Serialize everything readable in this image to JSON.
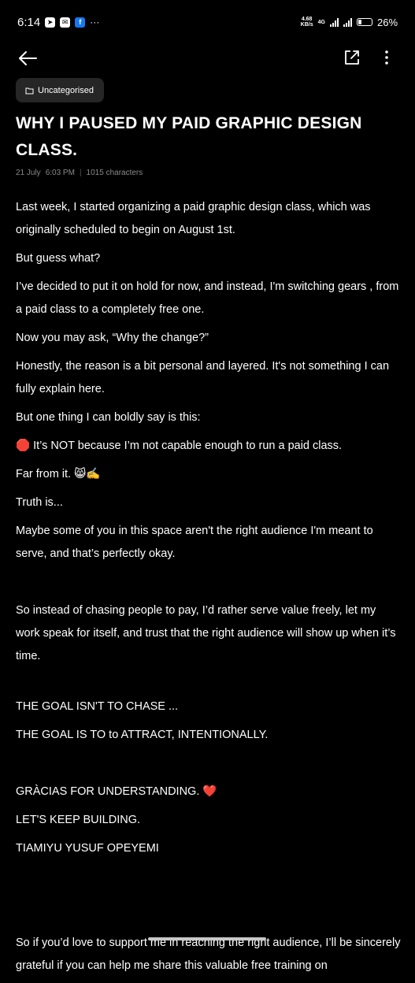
{
  "status_bar": {
    "time": "6:14",
    "net_speed_top": "4.68",
    "net_speed_bottom": "KB/s",
    "network_type": "4G",
    "battery_percent": "26",
    "battery_level": 0.26
  },
  "toolbar": {
    "back_icon": "arrow-left-icon",
    "share_icon": "external-share-icon",
    "more_icon": "vertical-ellipsis-icon"
  },
  "note": {
    "category": "Uncategorised",
    "title": "WHY I PAUSED MY PAID GRAPHIC DESIGN CLASS.",
    "date": "21 July",
    "time": "6:03 PM",
    "separator": "|",
    "char_count": "1015 characters",
    "paragraphs": {
      "p1": "Last week, I started organizing a paid graphic design class, which was originally scheduled to begin on August 1st.",
      "p2": "But guess what?",
      "p3": "I’ve decided to put it on hold for now, and instead, I'm switching gears , from a paid class to a completely free one.",
      "p4": "Now you may ask, “Why the change?”",
      "p5": "Honestly, the reason is a bit personal and layered. It's not something I can fully explain here.",
      "p6": "But one thing I can boldly say is this:",
      "p7": "🛑 It’s NOT because I’m not capable enough to run a paid class.",
      "p8": "Far from it. 😸✍️",
      "p9": "Truth is...",
      "p10": "Maybe some of you in this space aren't the right audience I'm meant to serve, and that’s perfectly okay.",
      "p11": "So instead of chasing people to pay, I’d rather serve value freely, let my work speak for itself, and trust that the right audience will show up when it’s time.",
      "p12": "THE GOAL ISN'T TO CHASE ...",
      "p13": "THE GOAL IS TO to ATTRACT, INTENTIONALLY.",
      "p14": "GRÀCIAS FOR UNDERSTANDING. ❤️",
      "p15": "LET'S KEEP BUILDING.",
      "p16": "TIAMIYU YUSUF OPEYEMI",
      "p17": "So if you’d love to support me in reaching the right audience, I’ll be sincerely grateful if you can help me share this valuable free training on"
    }
  }
}
